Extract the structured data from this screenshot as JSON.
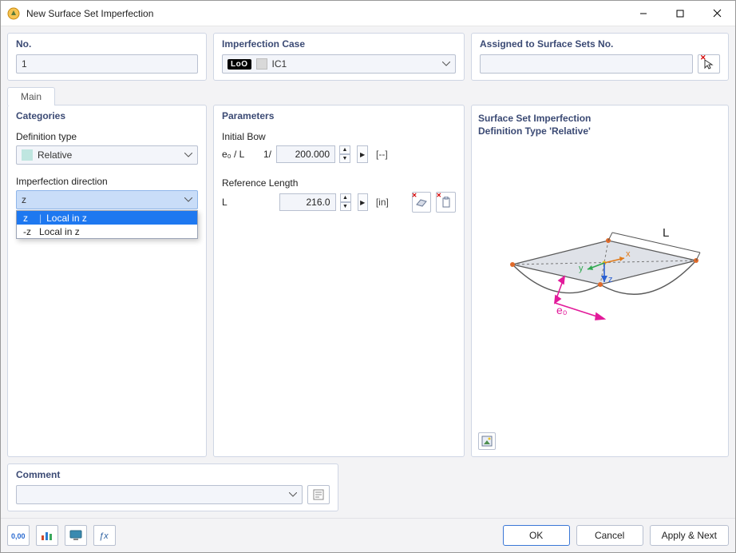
{
  "window": {
    "title": "New Surface Set Imperfection"
  },
  "top": {
    "no": {
      "header": "No.",
      "value": "1"
    },
    "imperfection": {
      "header": "Imperfection Case",
      "tag": "LoO",
      "value": "IC1"
    },
    "assigned": {
      "header": "Assigned to Surface Sets No.",
      "value": ""
    }
  },
  "tabs": {
    "main": "Main"
  },
  "categories": {
    "header": "Categories",
    "def_type_label": "Definition type",
    "def_type_value": "Relative",
    "direction_label": "Imperfection direction",
    "direction_value": "z",
    "direction_options": [
      {
        "key": "z",
        "label": "Local in z"
      },
      {
        "key": "-z",
        "label": "Local in z"
      }
    ]
  },
  "parameters": {
    "header": "Parameters",
    "initial_bow_label": "Initial Bow",
    "e0_lbl": "e₀ / L",
    "one_over": "1/",
    "e0_value": "200.000",
    "e0_unit": "[--]",
    "ref_len_label": "Reference Length",
    "L_lbl": "L",
    "L_value": "216.0",
    "L_unit": "[in]"
  },
  "preview": {
    "line1": "Surface Set Imperfection",
    "line2": "Definition Type 'Relative'",
    "axes": {
      "x": "x",
      "y": "y",
      "z": "z"
    },
    "L": "L",
    "e0": "e₀"
  },
  "comment": {
    "header": "Comment",
    "value": ""
  },
  "footer": {
    "ok": "OK",
    "cancel": "Cancel",
    "apply": "Apply & Next"
  }
}
